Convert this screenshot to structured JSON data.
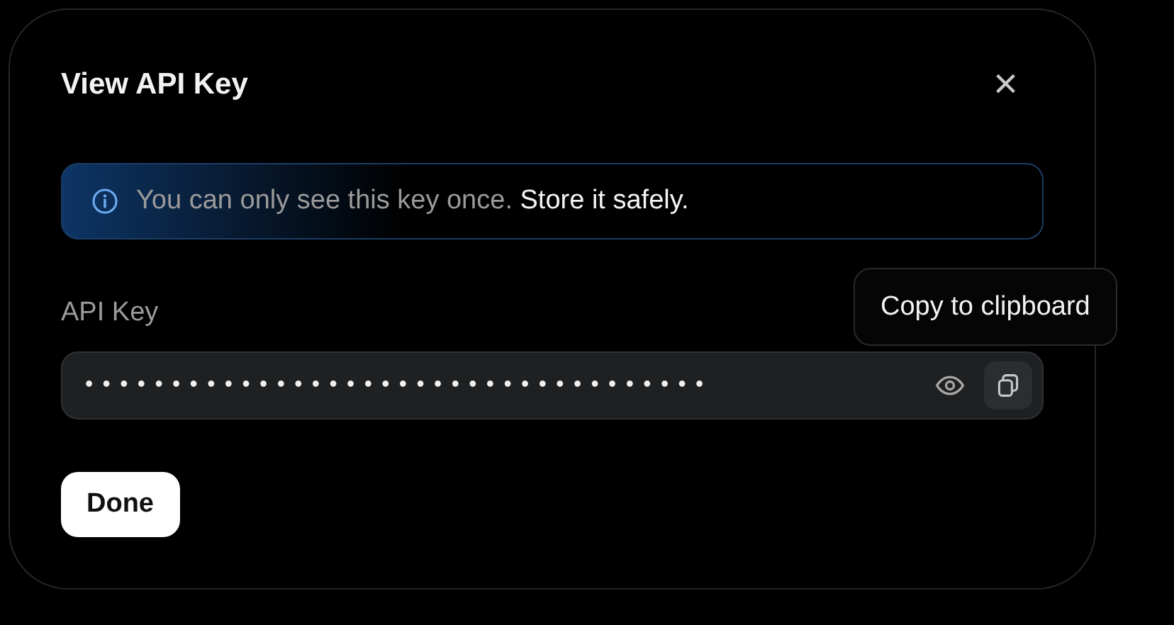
{
  "dialog": {
    "title": "View API Key",
    "close_icon": "×"
  },
  "notice": {
    "text": "You can only see this key once. **Store it safely.**"
  },
  "field": {
    "label": "API Key",
    "value": "••••••••••••••••••••••••••••••••••••"
  },
  "tooltip": {
    "text": "Copy to clipboard"
  },
  "buttons": [
    "Done"
  ]
}
